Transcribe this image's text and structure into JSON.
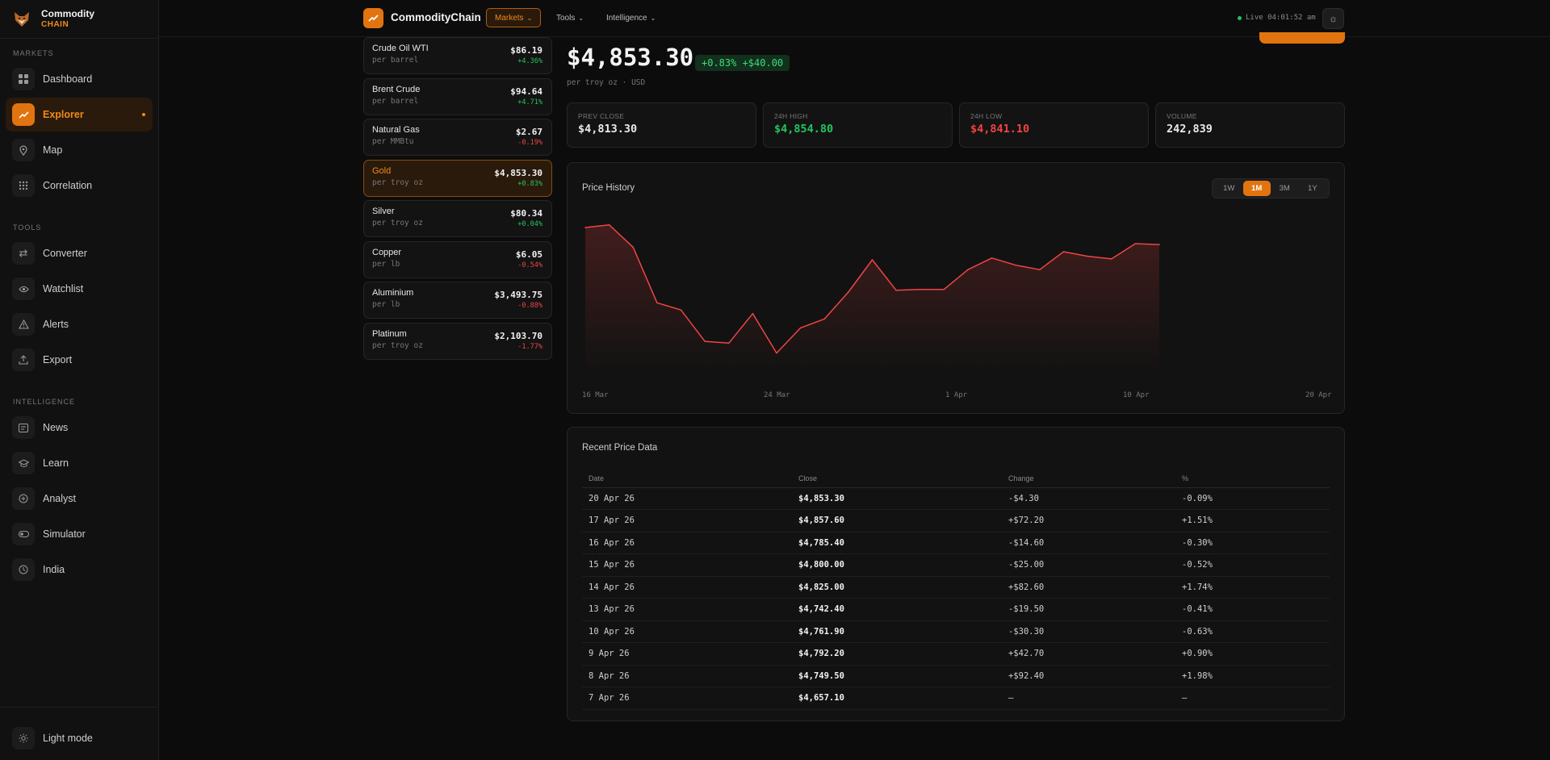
{
  "brand": {
    "name": "Commodity",
    "sub": "CHAIN"
  },
  "sidebar": {
    "sections": [
      {
        "label": "MARKETS",
        "items": [
          {
            "label": "Dashboard",
            "icon": "grid-icon"
          },
          {
            "label": "Explorer",
            "icon": "trend-icon",
            "active": true
          },
          {
            "label": "Map",
            "icon": "map-pin-icon"
          },
          {
            "label": "Correlation",
            "icon": "dots-grid-icon"
          }
        ]
      },
      {
        "label": "TOOLS",
        "items": [
          {
            "label": "Converter",
            "icon": "swap-icon"
          },
          {
            "label": "Watchlist",
            "icon": "eye-icon"
          },
          {
            "label": "Alerts",
            "icon": "warning-icon"
          },
          {
            "label": "Export",
            "icon": "upload-icon"
          }
        ]
      },
      {
        "label": "INTELLIGENCE",
        "items": [
          {
            "label": "News",
            "icon": "news-icon"
          },
          {
            "label": "Learn",
            "icon": "graduation-cap-icon"
          },
          {
            "label": "Analyst",
            "icon": "plus-circle-icon"
          },
          {
            "label": "Simulator",
            "icon": "toggle-icon"
          },
          {
            "label": "India",
            "icon": "clock-icon"
          }
        ]
      }
    ],
    "footer": {
      "label": "Light mode"
    }
  },
  "topbar": {
    "name": "CommodityChain",
    "menus": [
      "Markets",
      "Tools",
      "Intelligence"
    ],
    "live": "Live 04:01:52 am"
  },
  "commodities": [
    {
      "name": "Crude Oil WTI",
      "unit": "per barrel",
      "price": "$86.19",
      "change": "+4.36%",
      "dir": "up"
    },
    {
      "name": "Brent Crude",
      "unit": "per barrel",
      "price": "$94.64",
      "change": "+4.71%",
      "dir": "up"
    },
    {
      "name": "Natural Gas",
      "unit": "per MMBtu",
      "price": "$2.67",
      "change": "-0.19%",
      "dir": "down"
    },
    {
      "name": "Gold",
      "unit": "per troy oz",
      "price": "$4,853.30",
      "change": "+0.83%",
      "dir": "up",
      "active": true
    },
    {
      "name": "Silver",
      "unit": "per troy oz",
      "price": "$80.34",
      "change": "+0.04%",
      "dir": "up"
    },
    {
      "name": "Copper",
      "unit": "per lb",
      "price": "$6.05",
      "change": "-0.54%",
      "dir": "down"
    },
    {
      "name": "Aluminium",
      "unit": "per lb",
      "price": "$3,493.75",
      "change": "-0.88%",
      "dir": "down"
    },
    {
      "name": "Platinum",
      "unit": "per troy oz",
      "price": "$2,103.70",
      "change": "-1.77%",
      "dir": "down"
    }
  ],
  "detail": {
    "price": "$4,853.30",
    "change_pill": "+0.83% +$40.00",
    "unit": "per troy oz · USD",
    "stats": [
      {
        "label": "PREV CLOSE",
        "value": "$4,813.30",
        "color": "#eaeaea"
      },
      {
        "label": "24H HIGH",
        "value": "$4,854.80",
        "color": "#22c55e"
      },
      {
        "label": "24H LOW",
        "value": "$4,841.10",
        "color": "#ef4444"
      },
      {
        "label": "VOLUME",
        "value": "242,839",
        "color": "#eaeaea"
      }
    ]
  },
  "history": {
    "title": "Price History",
    "ranges": [
      "1W",
      "1M",
      "3M",
      "1Y"
    ],
    "active_range": "1M"
  },
  "chart_data": {
    "type": "area",
    "x_ticks": [
      "16 Mar",
      "24 Mar",
      "1 Apr",
      "10 Apr",
      "20 Apr"
    ],
    "values": [
      4812,
      4815,
      4790,
      4728,
      4720,
      4685,
      4683,
      4716,
      4672,
      4700,
      4710,
      4740,
      4776,
      4742,
      4743,
      4743,
      4765,
      4778,
      4770,
      4765,
      4785,
      4780,
      4777,
      4794,
      4793
    ],
    "ylim": [
      4650,
      4830
    ],
    "color": "#ef4444"
  },
  "recent": {
    "title": "Recent Price Data",
    "headers": [
      "Date",
      "Close",
      "Change",
      "%"
    ],
    "rows": [
      {
        "date": "20 Apr 26",
        "close": "$4,853.30",
        "change": "-$4.30",
        "pct": "-0.09%",
        "dir": "down"
      },
      {
        "date": "17 Apr 26",
        "close": "$4,857.60",
        "change": "+$72.20",
        "pct": "+1.51%",
        "dir": "up"
      },
      {
        "date": "16 Apr 26",
        "close": "$4,785.40",
        "change": "-$14.60",
        "pct": "-0.30%",
        "dir": "down"
      },
      {
        "date": "15 Apr 26",
        "close": "$4,800.00",
        "change": "-$25.00",
        "pct": "-0.52%",
        "dir": "down"
      },
      {
        "date": "14 Apr 26",
        "close": "$4,825.00",
        "change": "+$82.60",
        "pct": "+1.74%",
        "dir": "up"
      },
      {
        "date": "13 Apr 26",
        "close": "$4,742.40",
        "change": "-$19.50",
        "pct": "-0.41%",
        "dir": "down"
      },
      {
        "date": "10 Apr 26",
        "close": "$4,761.90",
        "change": "-$30.30",
        "pct": "-0.63%",
        "dir": "down"
      },
      {
        "date": "9 Apr 26",
        "close": "$4,792.20",
        "change": "+$42.70",
        "pct": "+0.90%",
        "dir": "up"
      },
      {
        "date": "8 Apr 26",
        "close": "$4,749.50",
        "change": "+$92.40",
        "pct": "+1.98%",
        "dir": "up"
      },
      {
        "date": "7 Apr 26",
        "close": "$4,657.10",
        "change": "—",
        "pct": "—",
        "dir": "neutral"
      }
    ]
  }
}
